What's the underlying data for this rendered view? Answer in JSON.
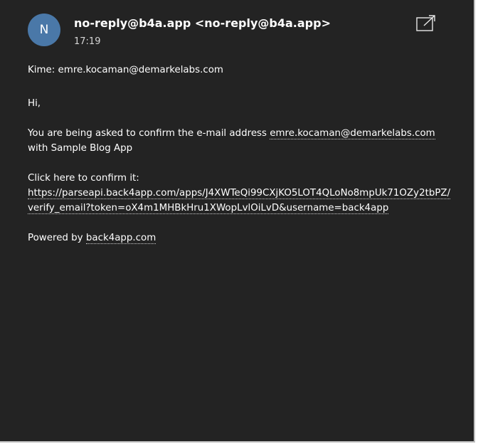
{
  "header": {
    "avatar_initial": "N",
    "sender": "no-reply@b4a.app <no-reply@b4a.app>",
    "time": "17:19",
    "popout_icon": "popout-window-icon"
  },
  "message": {
    "to_line": "Kime: emre.kocaman@demarkelabs.com",
    "greeting": "Hi,",
    "confirm_text_before": "You are being asked to confirm the e-mail address ",
    "confirm_email": "emre.kocaman@demarkelabs.com",
    "confirm_text_after": "with Sample Blog App",
    "click_here": "Click here to confirm it:",
    "verify_link": "https://parseapi.back4app.com/apps/J4XWTeQi99CXjKO5LOT4QLoNo8mpUk71OZy2tbPZ/verify_email?token=oX4m1MHBkHru1XWopLvlOiLvD&username=back4app",
    "powered_by": "Powered by ",
    "powered_link": "back4app.com"
  },
  "colors": {
    "background": "#232323",
    "avatar": "#4a78a8",
    "text": "#ffffff"
  }
}
